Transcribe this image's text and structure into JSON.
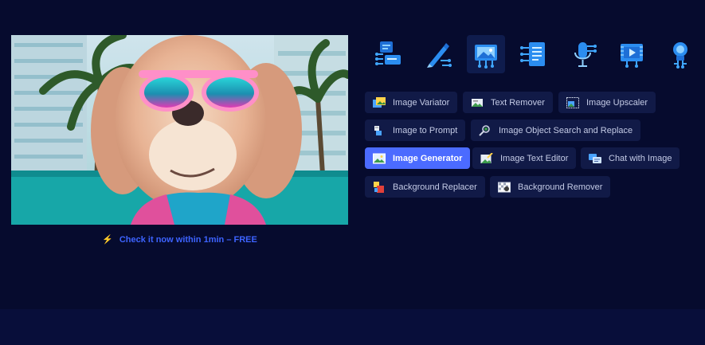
{
  "cta": {
    "icon": "lightning-icon",
    "text": "Check it now within 1min – FREE"
  },
  "hero": {
    "icon": "dog-with-sunglasses-image"
  },
  "categories": [
    {
      "icon": "chat-bot-icon",
      "active": false
    },
    {
      "icon": "magic-pen-icon",
      "active": false
    },
    {
      "icon": "image-circuit-icon",
      "active": true
    },
    {
      "icon": "document-circuit-icon",
      "active": false
    },
    {
      "icon": "microphone-circuit-icon",
      "active": false
    },
    {
      "icon": "video-circuit-icon",
      "active": false
    },
    {
      "icon": "lightbulb-circuit-icon",
      "active": false
    }
  ],
  "tools": {
    "image_variator": "Image Variator",
    "text_remover": "Text Remover",
    "image_upscaler": "Image Upscaler",
    "image_to_prompt": "Image to Prompt",
    "image_object_search_replace": "Image Object Search and Replace",
    "image_generator": "Image Generator",
    "image_text_editor": "Image Text Editor",
    "chat_with_image": "Chat with Image",
    "background_replacer": "Background Replacer",
    "background_remover": "Background Remover"
  },
  "colors": {
    "accent": "#4b6bff",
    "link": "#3d63ff",
    "bolt": "#f5c400",
    "background": "#060b2e"
  }
}
